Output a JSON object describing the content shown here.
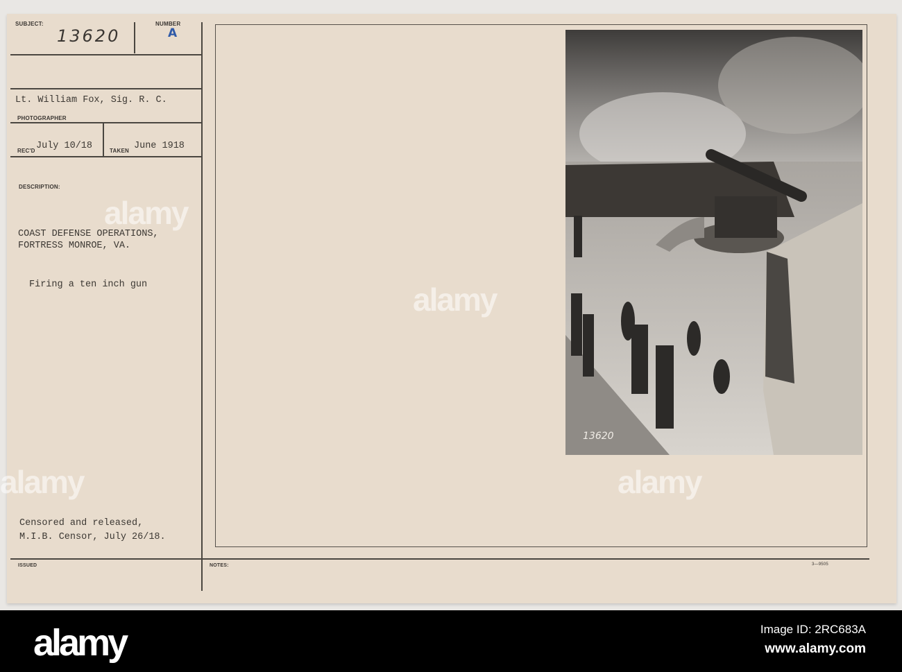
{
  "card": {
    "subject_label": "SUBJECT:",
    "subject_value": "13620",
    "number_label": "NUMBER",
    "number_value": "A",
    "photographer_value": "Lt. William Fox, Sig. R. C.",
    "photographer_label": "PHOTOGRAPHER",
    "recd_label": "REC'D",
    "recd_value": "July 10/18",
    "taken_label": "TAKEN",
    "taken_value": "June 1918",
    "description_label": "DESCRIPTION:",
    "description_line1": "COAST DEFENSE OPERATIONS,",
    "description_line2": "FORTRESS MONROE, VA.",
    "caption": "Firing a ten inch gun",
    "censor_line1": "Censored and released,",
    "censor_line2": "M.I.B. Censor, July 26/18.",
    "issued_label": "ISSUED",
    "notes_label": "NOTES:",
    "form_number": "3—9505"
  },
  "photo": {
    "negative_number": "13620"
  },
  "colors": {
    "card": "#e8dccd",
    "stamp": "#2f5aa8",
    "band": "#000000"
  },
  "watermark": {
    "text": "alamy"
  },
  "footer": {
    "logo": "alamy",
    "image_id": "Image ID: 2RC683A",
    "url": "www.alamy.com"
  }
}
